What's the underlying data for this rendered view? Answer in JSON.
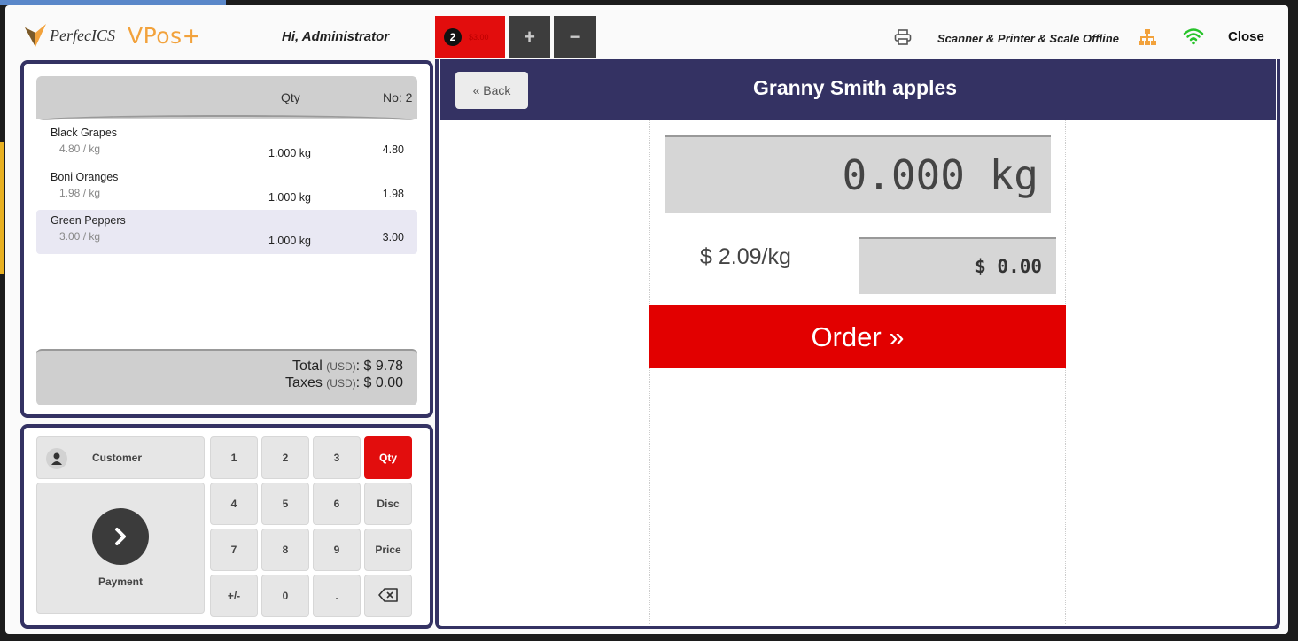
{
  "header": {
    "logo_text": "PerfecICS",
    "brand": "VPos+",
    "greeting": "Hi, Administrator",
    "order_tab": {
      "badge": "2",
      "amount": "$3.00"
    },
    "add_tab_icon": "+",
    "remove_tab_icon": "−",
    "device_status": "Scanner & Printer & Scale Offline",
    "close_label": "Close",
    "icons": [
      "printer-icon",
      "network-icon",
      "wifi-icon"
    ],
    "colors": {
      "wifi": "#27c32a",
      "network": "#f2a23c"
    }
  },
  "cart": {
    "col_qty": "Qty",
    "col_no": "No: 2",
    "items": [
      {
        "name": "Black Grapes",
        "unit": "4.80 / kg",
        "qty": "1.000 kg",
        "price": "4.80",
        "selected": false
      },
      {
        "name": "Boni Oranges",
        "unit": "1.98 / kg",
        "qty": "1.000 kg",
        "price": "1.98",
        "selected": false
      },
      {
        "name": "Green Peppers",
        "unit": "3.00 / kg",
        "qty": "1.000 kg",
        "price": "3.00",
        "selected": true
      }
    ],
    "total_label": "Total",
    "taxes_label": "Taxes",
    "currency_note": "(USD)",
    "total_value": "$ 9.78",
    "taxes_value": "$ 0.00"
  },
  "keypad": {
    "customer_label": "Customer",
    "payment_label": "Payment",
    "keys": [
      "1",
      "2",
      "3",
      "Qty",
      "4",
      "5",
      "6",
      "Disc",
      "7",
      "8",
      "9",
      "Price",
      "+/-",
      "0",
      ".",
      "backspace"
    ],
    "active_key": "Qty",
    "accent": "#e20d0d"
  },
  "product": {
    "back_label": "« Back",
    "title": "Granny Smith apples",
    "weight": "0.000 kg",
    "unit_price": "$ 2.09/kg",
    "amount": "$ 0.00",
    "order_label": "Order »",
    "colors": {
      "header": "#343263",
      "order": "#e20000"
    }
  }
}
